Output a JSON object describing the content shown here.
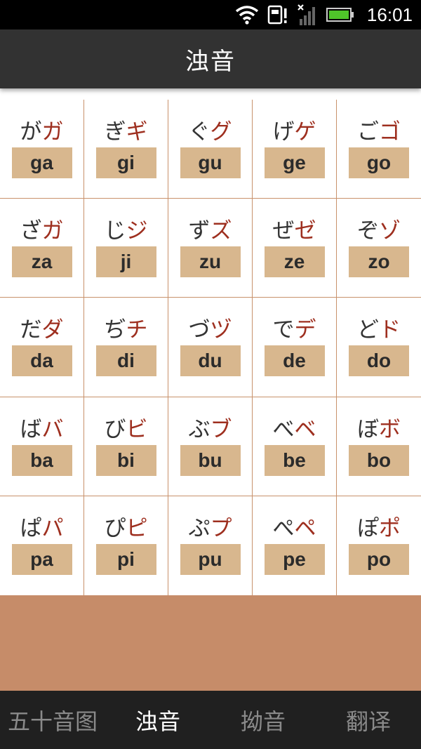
{
  "status": {
    "time": "16:01"
  },
  "header": {
    "title": "浊音"
  },
  "grid": [
    {
      "hira": "が",
      "kata": "ガ",
      "romaji": "ga"
    },
    {
      "hira": "ぎ",
      "kata": "ギ",
      "romaji": "gi"
    },
    {
      "hira": "ぐ",
      "kata": "グ",
      "romaji": "gu"
    },
    {
      "hira": "げ",
      "kata": "ゲ",
      "romaji": "ge"
    },
    {
      "hira": "ご",
      "kata": "ゴ",
      "romaji": "go"
    },
    {
      "hira": "ざ",
      "kata": "ガ",
      "romaji": "za"
    },
    {
      "hira": "じ",
      "kata": "ジ",
      "romaji": "ji"
    },
    {
      "hira": "ず",
      "kata": "ズ",
      "romaji": "zu"
    },
    {
      "hira": "ぜ",
      "kata": "ゼ",
      "romaji": "ze"
    },
    {
      "hira": "ぞ",
      "kata": "ゾ",
      "romaji": "zo"
    },
    {
      "hira": "だ",
      "kata": "ダ",
      "romaji": "da"
    },
    {
      "hira": "ぢ",
      "kata": "チ",
      "romaji": "di"
    },
    {
      "hira": "づ",
      "kata": "ヅ",
      "romaji": "du"
    },
    {
      "hira": "で",
      "kata": "デ",
      "romaji": "de"
    },
    {
      "hira": "ど",
      "kata": "ド",
      "romaji": "do"
    },
    {
      "hira": "ば",
      "kata": "バ",
      "romaji": "ba"
    },
    {
      "hira": "び",
      "kata": "ビ",
      "romaji": "bi"
    },
    {
      "hira": "ぶ",
      "kata": "ブ",
      "romaji": "bu"
    },
    {
      "hira": "べ",
      "kata": "ベ",
      "romaji": "be"
    },
    {
      "hira": "ぼ",
      "kata": "ボ",
      "romaji": "bo"
    },
    {
      "hira": "ぱ",
      "kata": "パ",
      "romaji": "pa"
    },
    {
      "hira": "ぴ",
      "kata": "ピ",
      "romaji": "pi"
    },
    {
      "hira": "ぷ",
      "kata": "プ",
      "romaji": "pu"
    },
    {
      "hira": "ぺ",
      "kata": "ペ",
      "romaji": "pe"
    },
    {
      "hira": "ぽ",
      "kata": "ポ",
      "romaji": "po"
    }
  ],
  "tabs": [
    {
      "label": "五十音图",
      "active": false
    },
    {
      "label": "浊音",
      "active": true
    },
    {
      "label": "拗音",
      "active": false
    },
    {
      "label": "翻译",
      "active": false
    }
  ],
  "colors": {
    "header_bg": "#323232",
    "katakana": "#9e2f1f",
    "romaji_bg": "#d8b78e",
    "grid_line": "#c8916b",
    "panel_bg": "#c68c69",
    "tab_bar_bg": "#202020"
  },
  "icons": [
    "wifi-icon",
    "storage-alert-icon",
    "cell-signal-icon",
    "battery-icon"
  ]
}
